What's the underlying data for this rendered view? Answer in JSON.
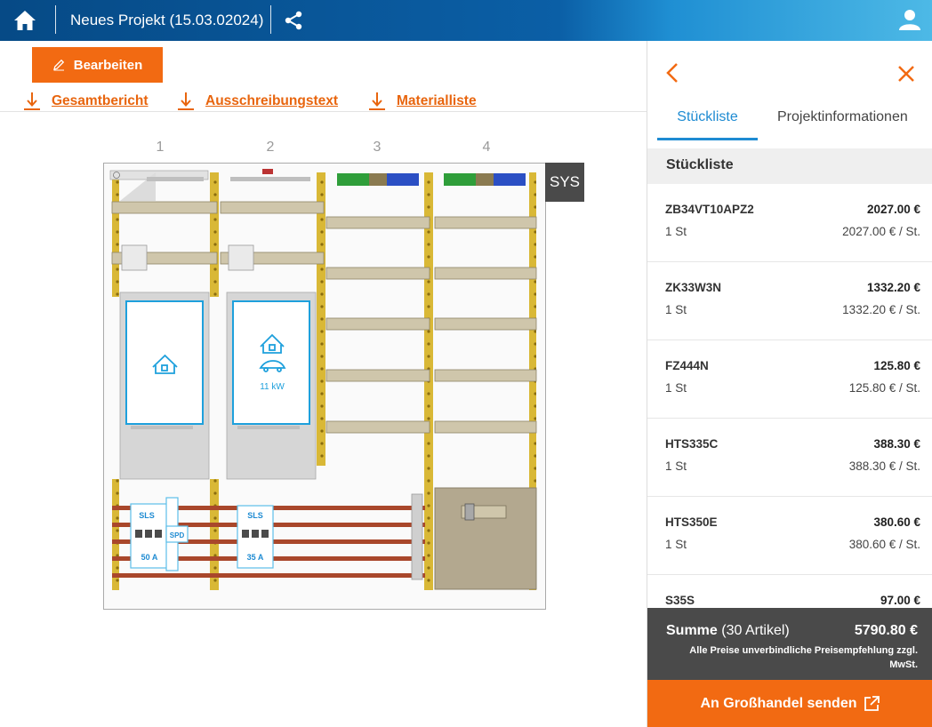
{
  "header": {
    "project_title": "Neues Projekt (15.03.02024)"
  },
  "toolbar": {
    "edit_label": "Bearbeiten",
    "downloads": [
      "Gesamtbericht",
      "Ausschreibungstext",
      "Materialliste"
    ]
  },
  "cabinet": {
    "columns": [
      "1",
      "2",
      "3",
      "4"
    ],
    "sys_label": "SYS",
    "meter_2_power": "11 kW",
    "breakers": [
      {
        "type": "SLS",
        "rating": "50 A"
      },
      {
        "type": "SLS",
        "rating": "35 A"
      }
    ],
    "spd_label": "SPD"
  },
  "panel": {
    "tabs": [
      "Stückliste",
      "Projektinformationen"
    ],
    "list_title": "Stückliste",
    "items": [
      {
        "code": "ZB34VT10APZ2",
        "total": "2027.00 €",
        "qty": "1 St",
        "unit_price": "2027.00 € / St."
      },
      {
        "code": "ZK33W3N",
        "total": "1332.20 €",
        "qty": "1 St",
        "unit_price": "1332.20 € / St."
      },
      {
        "code": "FZ444N",
        "total": "125.80 €",
        "qty": "1 St",
        "unit_price": "125.80 € / St."
      },
      {
        "code": "HTS335C",
        "total": "388.30 €",
        "qty": "1 St",
        "unit_price": "388.30 € / St."
      },
      {
        "code": "HTS350E",
        "total": "380.60 €",
        "qty": "1 St",
        "unit_price": "380.60 € / St."
      },
      {
        "code": "S35S",
        "total": "97.00 €",
        "qty": "",
        "unit_price": ""
      }
    ],
    "sum_label": "Summe",
    "sum_count": "(30 Artikel)",
    "sum_amount": "5790.80 €",
    "sum_note": "Alle Preise unverbindliche Preisempfehlung zzgl. MwSt.",
    "send_label": "An Großhandel senden"
  },
  "colors": {
    "accent": "#f26a12",
    "primary": "#1e8bd2",
    "header_dark": "#064a86",
    "rail": "#d9b836",
    "busbar": "#a9472b"
  }
}
